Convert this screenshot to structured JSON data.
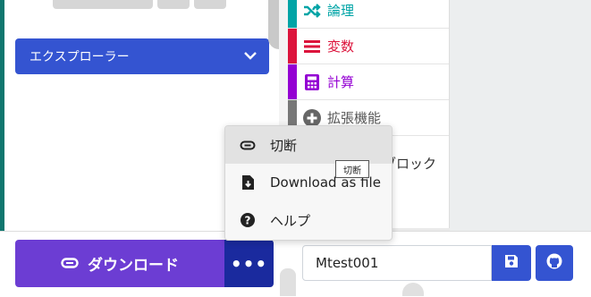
{
  "sidebar": {
    "explorer_label": "エクスプローラー"
  },
  "toolbox": {
    "categories": [
      {
        "label": "論理",
        "color": "#00a4a6",
        "text_color": "#00a4a6",
        "icon": "shuffle-icon"
      },
      {
        "label": "変数",
        "color": "#dc143c",
        "text_color": "#dc143c",
        "icon": "list-icon"
      },
      {
        "label": "計算",
        "color": "#9400d3",
        "text_color": "#9400d3",
        "icon": "calculator-icon"
      },
      {
        "label": "拡張機能",
        "color": "#777777",
        "text_color": "#555555",
        "icon": "plus-circle-icon"
      },
      {
        "label": "ブロック",
        "color": "#ffffff",
        "text_color": "#333333",
        "icon": ""
      }
    ]
  },
  "bottom": {
    "download_label": "ダウンロード",
    "more_label": "•••",
    "project_name": "Mtest001"
  },
  "menu": {
    "items": [
      {
        "label": "切断",
        "icon": "usb-link-icon"
      },
      {
        "label": "Download as file",
        "icon": "file-download-icon"
      },
      {
        "label": "ヘルプ",
        "icon": "help-circle-icon"
      }
    ],
    "tooltip": "切断"
  },
  "colors": {
    "accent": "#3454d1",
    "download": "#6c3dd3",
    "more": "#1a2a9e"
  }
}
